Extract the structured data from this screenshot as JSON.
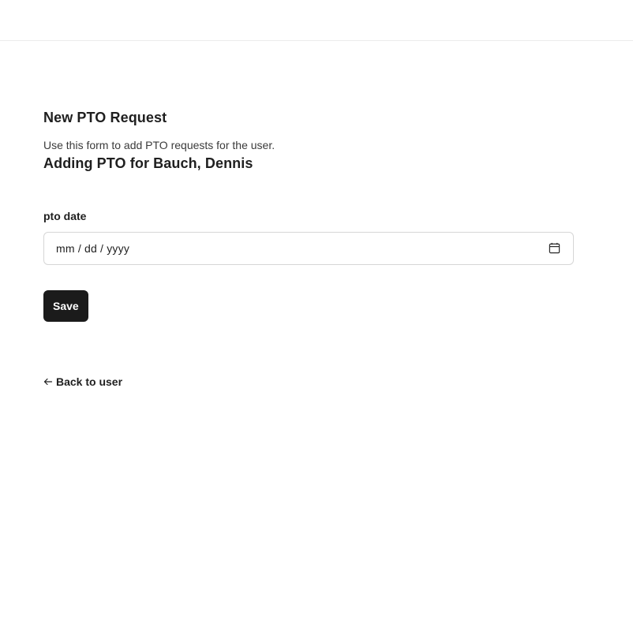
{
  "form": {
    "title": "New PTO Request",
    "description": "Use this form to add PTO requests for the user.",
    "subtitle": "Adding PTO for Bauch, Dennis",
    "date_field": {
      "label": "pto date",
      "placeholder": "mm / dd / yyyy",
      "icon": "calendar-icon"
    },
    "save_label": "Save"
  },
  "nav": {
    "back_label": "Back to user",
    "back_icon": "arrow-left-icon"
  },
  "colors": {
    "primary_button": "#1b1b1b",
    "border": "#d6d6d6",
    "text": "#1f1f1f"
  }
}
